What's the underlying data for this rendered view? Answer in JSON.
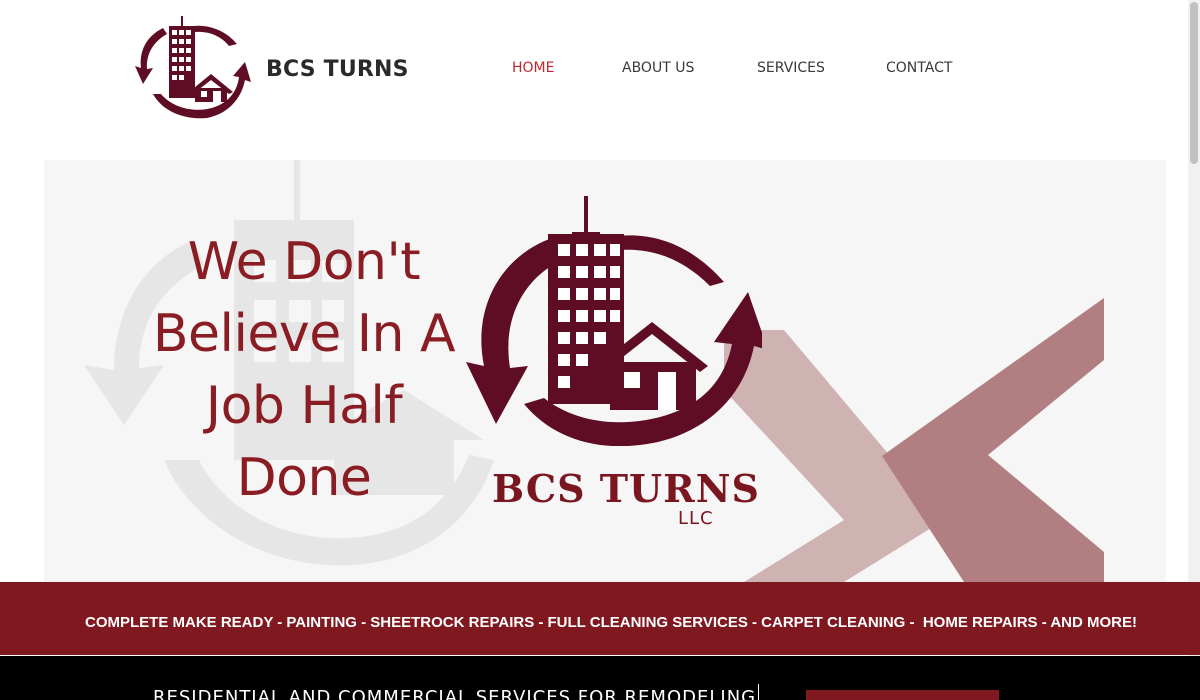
{
  "header": {
    "brand": "BCS TURNS",
    "logo_icon": "building-house-arrows-logo-icon"
  },
  "nav": {
    "items": [
      {
        "label": "HOME",
        "active": true
      },
      {
        "label": "ABOUT US",
        "active": false
      },
      {
        "label": "SERVICES",
        "active": false
      },
      {
        "label": "CONTACT",
        "active": false
      }
    ]
  },
  "hero": {
    "tagline_lines": [
      "We Don't",
      "Believe In A",
      "Job Half",
      "Done"
    ],
    "logo_brand": "BCS TURNS",
    "logo_suffix": "LLC"
  },
  "banner": {
    "services_text": "COMPLETE MAKE READY - PAINTING - SHEETROCK REPAIRS - FULL CLEANING SERVICES - CARPET CLEANING -  HOME REPAIRS - AND MORE!"
  },
  "footer_band": {
    "text": "RESIDENTIAL AND COMMERCIAL SERVICES FOR REMODELING"
  },
  "colors": {
    "accent": "#c4262e",
    "brand_maroon": "#801820",
    "logo_maroon": "#5e0d24",
    "chevron_light": "#cfb3b3",
    "chevron_dark": "#b17f82"
  }
}
